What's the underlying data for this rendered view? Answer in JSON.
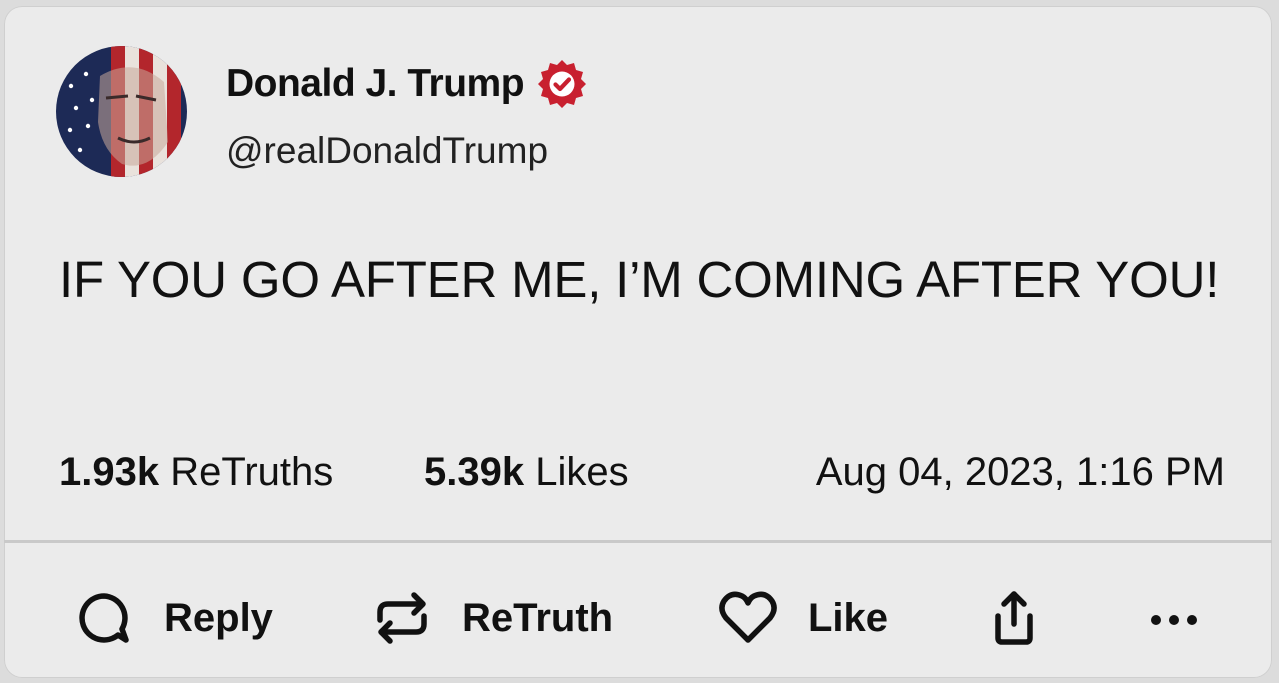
{
  "author": {
    "display_name": "Donald J. Trump",
    "handle": "@realDonaldTrump",
    "verified": true,
    "badge_color": "#c8202f"
  },
  "post": {
    "text": "IF YOU GO AFTER ME, I’M COMING AFTER YOU!"
  },
  "stats": {
    "retruths_count": "1.93k",
    "retruths_label": "ReTruths",
    "likes_count": "5.39k",
    "likes_label": "Likes",
    "timestamp": "Aug 04, 2023, 1:16 PM"
  },
  "actions": {
    "reply_label": "Reply",
    "retruth_label": "ReTruth",
    "like_label": "Like",
    "share_icon": "share-icon",
    "more_icon": "more-icon"
  }
}
